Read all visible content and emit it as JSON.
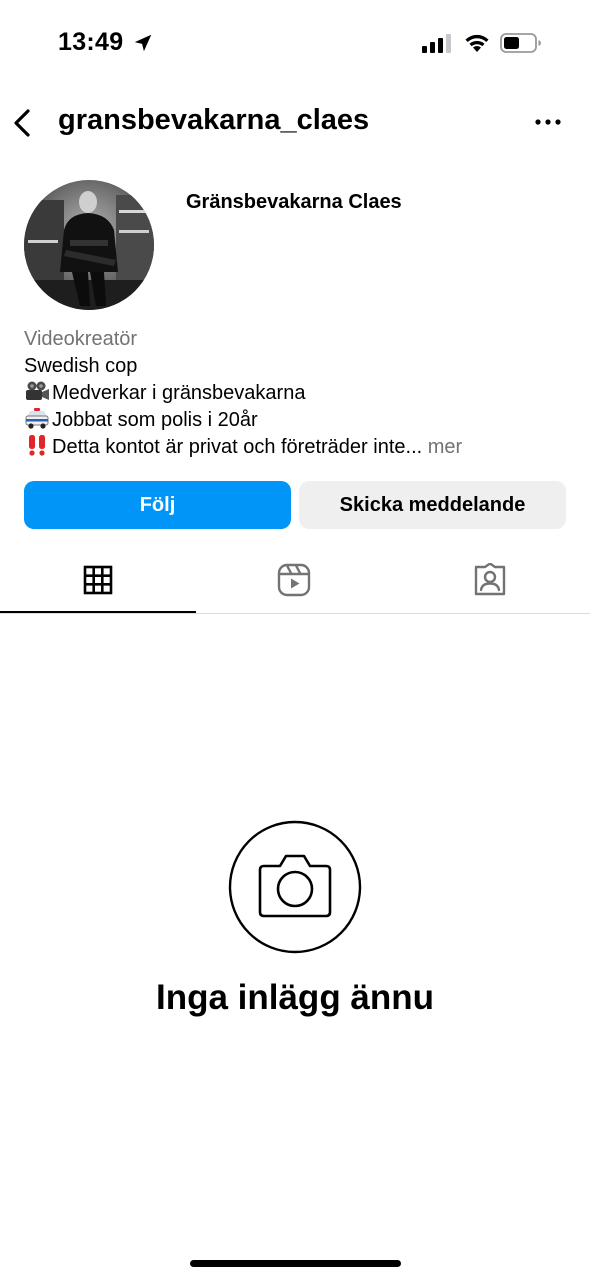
{
  "status_bar": {
    "time": "13:49"
  },
  "header": {
    "username": "gransbevakarna_claes"
  },
  "profile": {
    "display_name": "Gränsbevakarna Claes",
    "category": "Videokreatör",
    "bio_lines": [
      "Swedish cop",
      "Medverkar i gränsbevakarna",
      "Jobbat som polis i 20år",
      "Detta kontot är privat och företräder inte..."
    ],
    "bio_emojis": [
      "video-camera-icon",
      "police-car-icon",
      "double-exclamation-icon"
    ],
    "more_label": "mer"
  },
  "actions": {
    "follow_label": "Följ",
    "message_label": "Skicka meddelande"
  },
  "tabs": [
    {
      "name": "grid-icon",
      "active": true
    },
    {
      "name": "reels-icon",
      "active": false
    },
    {
      "name": "tagged-icon",
      "active": false
    }
  ],
  "empty_state": {
    "icon": "camera-icon",
    "text": "Inga inlägg ännu"
  },
  "colors": {
    "accent": "#0095f6",
    "secondary_button": "#efefef",
    "muted_text": "#737373",
    "warning": "#e0262b"
  }
}
